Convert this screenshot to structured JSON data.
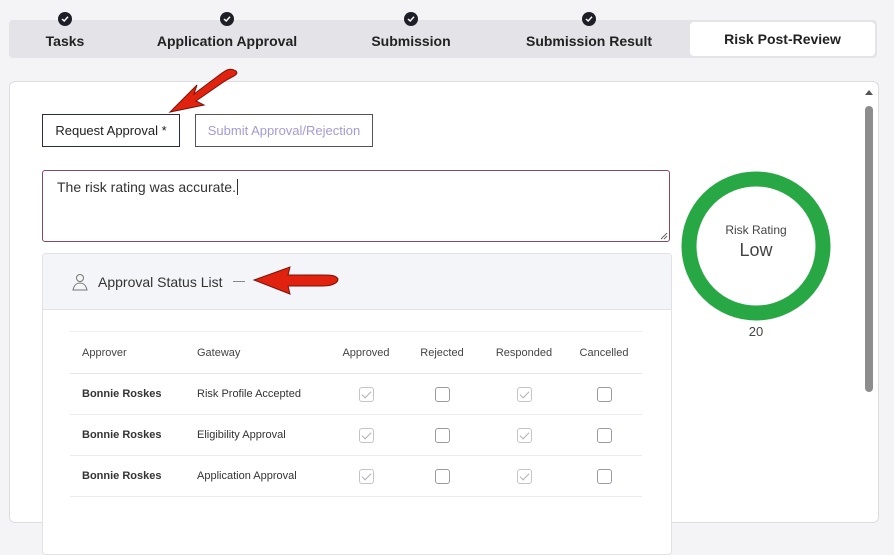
{
  "steps": [
    {
      "label": "Tasks",
      "completed": true
    },
    {
      "label": "Application Approval",
      "completed": true
    },
    {
      "label": "Submission",
      "completed": true
    },
    {
      "label": "Submission Result",
      "completed": true
    },
    {
      "label": "Risk Post-Review",
      "completed": false,
      "active": true
    }
  ],
  "buttons": {
    "request_approval": "Request Approval *",
    "submit_approval": "Submit Approval/Rejection"
  },
  "comment": {
    "value": "The risk rating was accurate."
  },
  "approval_panel": {
    "title": "Approval Status List",
    "columns": [
      "Approver",
      "Gateway",
      "Approved",
      "Rejected",
      "Responded",
      "Cancelled"
    ],
    "rows": [
      {
        "approver": "Bonnie Roskes",
        "gateway": "Risk Profile Accepted",
        "approved": true,
        "rejected": false,
        "responded": true,
        "cancelled": false
      },
      {
        "approver": "Bonnie Roskes",
        "gateway": "Eligibility Approval",
        "approved": true,
        "rejected": false,
        "responded": true,
        "cancelled": false
      },
      {
        "approver": "Bonnie Roskes",
        "gateway": "Application Approval",
        "approved": true,
        "rejected": false,
        "responded": true,
        "cancelled": false
      }
    ]
  },
  "risk": {
    "title": "Risk Rating",
    "value": "Low",
    "score": "20",
    "color": "#27a844"
  },
  "colors": {
    "annotation_arrow": "#e0220f",
    "gauge_ring": "#27a844"
  }
}
